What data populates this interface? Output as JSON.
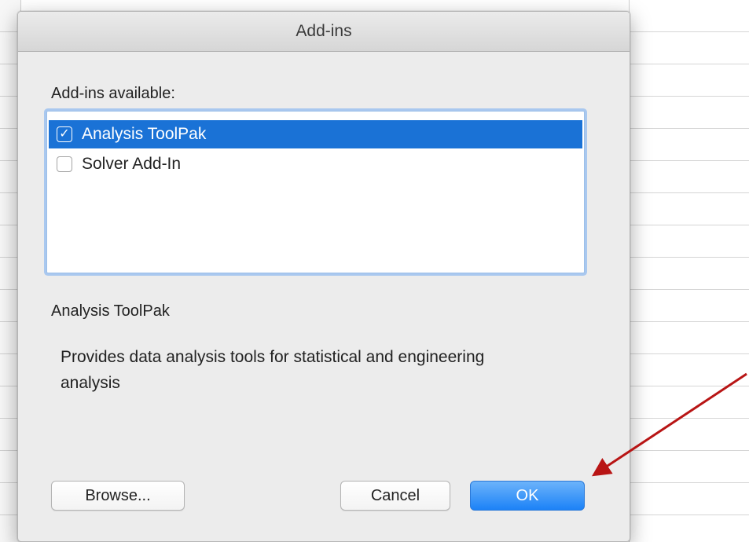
{
  "dialog": {
    "title": "Add-ins",
    "available_label": "Add-ins available:",
    "addins": [
      {
        "label": "Analysis ToolPak",
        "checked": true,
        "selected": true
      },
      {
        "label": "Solver Add-In",
        "checked": false,
        "selected": false
      }
    ],
    "selected_title": "Analysis ToolPak",
    "selected_description": "Provides data analysis tools for statistical and engineering analysis",
    "buttons": {
      "browse": "Browse...",
      "cancel": "Cancel",
      "ok": "OK"
    }
  },
  "icons": {
    "checkmark": "✓"
  },
  "colors": {
    "selection": "#1a72d6",
    "ok_button": "#1c82f7",
    "annotation_arrow": "#b81515"
  }
}
